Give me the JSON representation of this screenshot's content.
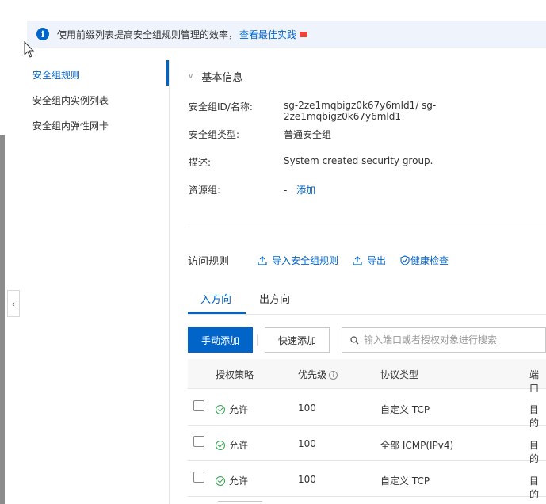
{
  "notice": {
    "text": "使用前缀列表提高安全组规则管理的效率，",
    "link": "查看最佳实践"
  },
  "sidebar": {
    "items": [
      {
        "label": "安全组规则",
        "active": true
      },
      {
        "label": "安全组内实例列表",
        "active": false
      },
      {
        "label": "安全组内弹性网卡",
        "active": false
      }
    ]
  },
  "basic_info": {
    "title": "基本信息",
    "fields": [
      {
        "label": "安全组ID/名称:",
        "value": "sg-2ze1mqbigz0k67y6mld1/ sg-2ze1mqbigz0k67y6mld1"
      },
      {
        "label": "安全组类型:",
        "value": "普通安全组"
      },
      {
        "label": "描述:",
        "value": "System created security group."
      },
      {
        "label": "资源组:",
        "value": "-",
        "link": "添加"
      }
    ]
  },
  "rules": {
    "title": "访问规则",
    "actions": {
      "import": "导入安全组规则",
      "export": "导出",
      "health": "健康检查"
    },
    "tabs": [
      "入方向",
      "出方向"
    ],
    "active_tab": "入方向",
    "buttons": {
      "manual_add": "手动添加",
      "quick_add": "快速添加"
    },
    "search_placeholder": "输入端口或者授权对象进行搜索",
    "columns": [
      "授权策略",
      "优先级",
      "协议类型",
      "端口"
    ],
    "rows": [
      {
        "policy": "允许",
        "priority": "100",
        "protocol": "自定义 TCP",
        "port": "目的"
      },
      {
        "policy": "允许",
        "priority": "100",
        "protocol": "全部 ICMP(IPv4)",
        "port": "目的"
      },
      {
        "policy": "允许",
        "priority": "100",
        "protocol": "自定义 TCP",
        "port": "目的"
      }
    ]
  },
  "colors": {
    "accent": "#0064c8",
    "notice_bg": "#eef3fc",
    "allow_green": "#2fa34d"
  }
}
